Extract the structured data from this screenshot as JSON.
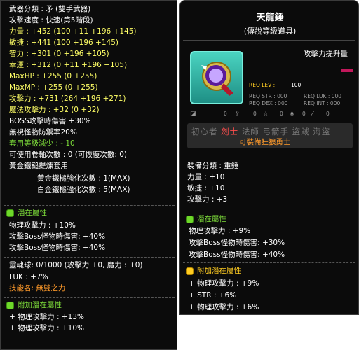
{
  "left": {
    "stats": [
      [
        "武器分類 : 矛 (雙手武器)",
        "w"
      ],
      [
        "攻擊速度 : 快速(第5階段)",
        "w"
      ],
      [
        "力量 : +452 (100 +11 +196 +145)",
        "y"
      ],
      [
        "敏捷 : +441 (100 +196 +145)",
        "y"
      ],
      [
        "智力 : +301 (0 +196 +105)",
        "y"
      ],
      [
        "幸運 : +312 (0 +11 +196 +105)",
        "y"
      ],
      [
        "MaxHP : +255 (0 +255)",
        "y"
      ],
      [
        "MaxMP : +255 (0 +255)",
        "y"
      ],
      [
        "攻擊力 : +731 (264 +196 +271)",
        "y"
      ],
      [
        "魔法攻擊力 : +32 (0 +32)",
        "y"
      ],
      [
        "BOSS攻擊時傷害 +30%",
        "w"
      ],
      [
        "無視怪物防禦率20%",
        "w"
      ],
      [
        "套用等級減少 : - 10",
        "g"
      ],
      [
        "可使用卷軸次數 : 0 (可恢復次數: 0)",
        "w"
      ],
      [
        "黃金鐵鎚提煉套用",
        "w"
      ],
      [
        "黃金鐵槌強化次數 : 1(MAX)",
        "w"
      ],
      [
        "白金鐵槌強化次數 : 5(MAX)",
        "w"
      ]
    ],
    "potential_title": "潛在屬性",
    "potential": [
      "物理攻擊力 : +10%",
      "攻擊Boss怪物時傷害: +40%",
      "攻擊Boss怪物時傷害: +40%"
    ],
    "soul": [
      "靈魂球: 0/1000 (攻擊力 +0, 魔力 : +0)",
      "LUK : +7%"
    ],
    "skill_label": "技能名: 無雙之力",
    "bonus_title": "附加潛在屬性",
    "bonus": [
      "+ 物理攻擊力 : +13%",
      "+ 物理攻擊力 : +10%"
    ]
  },
  "right": {
    "title": "天龍錘",
    "subtitle": "(傳說等級道具)",
    "attack_up": "攻擊力提升量",
    "req_lev_label": "REQ LEV :",
    "req_lev_value": "100",
    "req_str": "REQ STR : 000",
    "req_luk": "REQ LUK : 000",
    "req_dex": "REQ DEX : 000",
    "req_int": "REQ INT : 000",
    "icon_values": [
      "0",
      "0",
      "0",
      "0",
      "0"
    ],
    "jobs": [
      "初心者",
      "劍士",
      "法師",
      "弓箭手",
      "盜賊",
      "海盜"
    ],
    "active_job": "劍士",
    "usable_note": "可裝備狂狼勇士",
    "category": "裝備分類 : 重錘",
    "stats": [
      "力量 : +10",
      "敏捷 : +10",
      "攻擊力 : +3"
    ],
    "potential_title": "潛在屬性",
    "potential": [
      "物理攻擊力 : +9%",
      "攻擊Boss怪物時傷害: +30%",
      "攻擊Boss怪物時傷害: +40%"
    ],
    "bonus_title": "附加潛在屬性",
    "bonus": [
      "+ 物理攻擊力 : +9%",
      "+ STR : +6%",
      "+ 物理攻擊力 : +6%"
    ]
  }
}
